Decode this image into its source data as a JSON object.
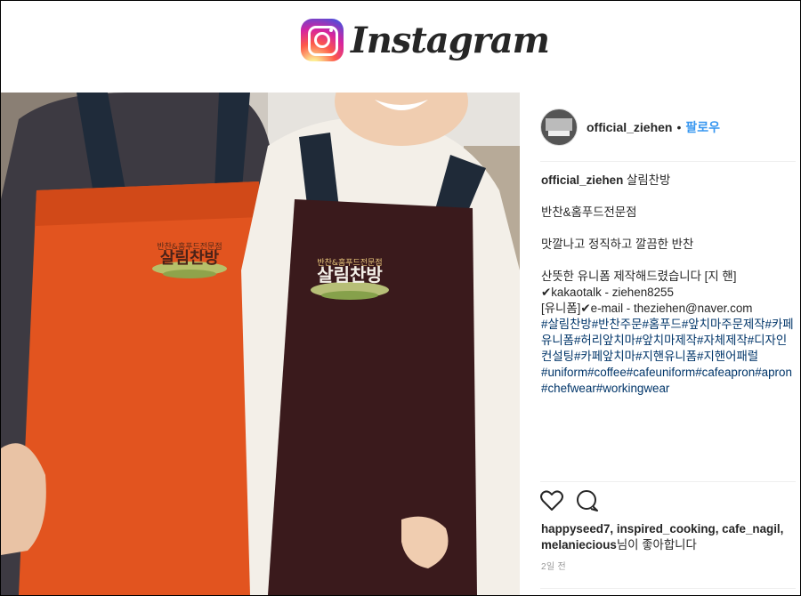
{
  "brand": {
    "wordmark": "Instagram"
  },
  "post": {
    "username": "official_ziehen",
    "separator": "•",
    "follow_label": "팔로우",
    "caption": {
      "first_line": "살림찬방",
      "line2": "반찬&홈푸드전문점",
      "line3": "맛깔나고 정직하고 깔끔한 반찬",
      "line4": "산뜻한 유니폼 제작해드렸습니다 [지 핸]",
      "line5": "✔kakaotalk - ziehen8255",
      "line6": "[유니폼]✔e-mail - theziehen@naver.com",
      "hashtags_ko": "#살림찬방#반찬주문#홈푸드#앞치마주문제작#카페유니폼#허리앞치마#앞치마제작#자체제작#디자인컨설팅#카페앞치마#지핸유니폼#지핸어패럴",
      "hashtags_en": "#uniform#coffee#cafeuniform#cafeapron#apron#chefwear#workingwear"
    },
    "likes": {
      "users": "happyseed7, inspired_cooking, cafe_nagil, melaniecious",
      "suffix": "님이 좋아합니다"
    },
    "timestamp": "2일 전"
  },
  "photo": {
    "apron_left_text": "살림찬방",
    "apron_left_small": "반찬&홈푸드전문점",
    "apron_right_text": "살림찬방",
    "apron_right_small": "반찬&홈푸드전문점"
  },
  "icons": {
    "like": "heart-icon",
    "comment": "comment-icon"
  }
}
